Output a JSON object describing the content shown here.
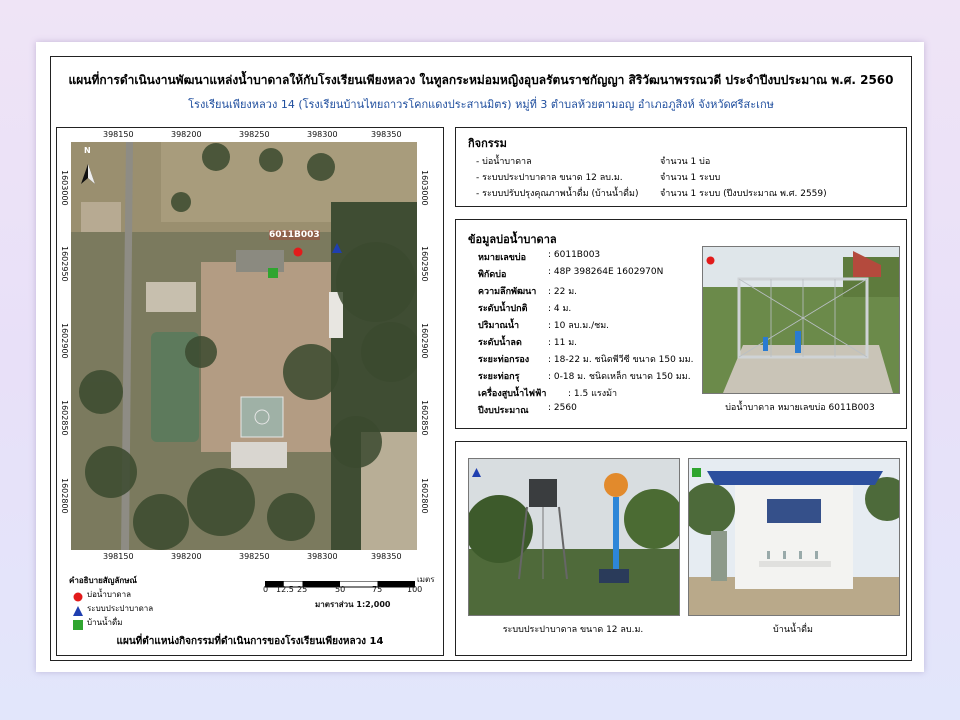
{
  "title": "แผนที่การดำเนินงานพัฒนาแหล่งน้ำบาดาลให้กับโรงเรียนเพียงหลวง ในทูลกระหม่อมหญิงอุบลรัตนราชกัญญา สิริวัฒนาพรรณวดี ประจำปีงบประมาณ พ.ศ. 2560",
  "subtitle": "โรงเรียนเพียงหลวง 14 (โรงเรียนบ้านไทยถาวรโคกแดงประสานมิตร) หมู่ที่ 3 ตำบลห้วยตามอญ อำเภอภูสิงห์ จังหวัดศรีสะเกษ",
  "map": {
    "x_ticks": [
      "398150",
      "398200",
      "398250",
      "398300",
      "398350"
    ],
    "y_ticks": [
      "1603000",
      "1602950",
      "1602900",
      "1602850",
      "1602800"
    ],
    "well_label": "6011B003",
    "north_label": "N",
    "legend_title": "คำอธิบายสัญลักษณ์",
    "legend": [
      {
        "label": "บ่อน้ำบาดาล",
        "color": "#e21b1b",
        "shape": "circle"
      },
      {
        "label": "ระบบประปาบาดาล",
        "color": "#1f3fb0",
        "shape": "triangle"
      },
      {
        "label": "บ้านน้ำดื่ม",
        "color": "#2fa52f",
        "shape": "square"
      }
    ],
    "scale_labels": [
      "0",
      "12.5",
      "25",
      "50",
      "75",
      "100"
    ],
    "scale_unit": "เมตร",
    "scale_ratio": "มาตราส่วน 1:2,000",
    "caption": "แผนที่ตำแหน่งกิจกรรมที่ดำเนินการของโรงเรียนเพียงหลวง 14"
  },
  "activities": {
    "title": "กิจกรรม",
    "items": [
      {
        "name": "- บ่อน้ำบาดาล",
        "amount": "จำนวน 1 บ่อ"
      },
      {
        "name": "- ระบบประปาบาดาล ขนาด 12 ลบ.ม.",
        "amount": "จำนวน 1 ระบบ"
      },
      {
        "name": "- ระบบปรับปรุงคุณภาพน้ำดื่ม (บ้านน้ำดื่ม)",
        "amount": "จำนวน 1 ระบบ  (ปีงบประมาณ พ.ศ. 2559)"
      }
    ]
  },
  "well_info": {
    "title": "ข้อมูลบ่อน้ำบาดาล",
    "rows": [
      {
        "key": "หมายเลขบ่อ",
        "value": ": 6011B003"
      },
      {
        "key": "พิกัดบ่อ",
        "value": ": 48P 398264E 1602970N"
      },
      {
        "key": "ความลึกพัฒนา",
        "value": ": 22 ม."
      },
      {
        "key": "ระดับน้ำปกติ",
        "value": ": 4 ม."
      },
      {
        "key": "ปริมาณน้ำ",
        "value": ": 10 ลบ.ม./ชม."
      },
      {
        "key": "ระดับน้ำลด",
        "value": ": 11 ม."
      },
      {
        "key": "ระยะท่อกรอง",
        "value": ": 18-22 ม. ชนิดพีวีซี  ขนาด 150 มม."
      },
      {
        "key": "ระยะท่อกรุ",
        "value": ": 0-18 ม.  ชนิดเหล็ก  ขนาด 150 มม."
      },
      {
        "key": "เครื่องสูบน้ำไฟฟ้า",
        "value": ": 1.5 แรงม้า"
      },
      {
        "key": "ปีงบประมาณ",
        "value": ":  2560"
      }
    ],
    "photo_caption": "บ่อน้ำบาดาล หมายเลขบ่อ 6011B003"
  },
  "photos": {
    "water_system_caption": "ระบบประปาบาดาล ขนาด 12 ลบ.ม.",
    "drinking_house_caption": "บ้านน้ำดื่ม"
  }
}
